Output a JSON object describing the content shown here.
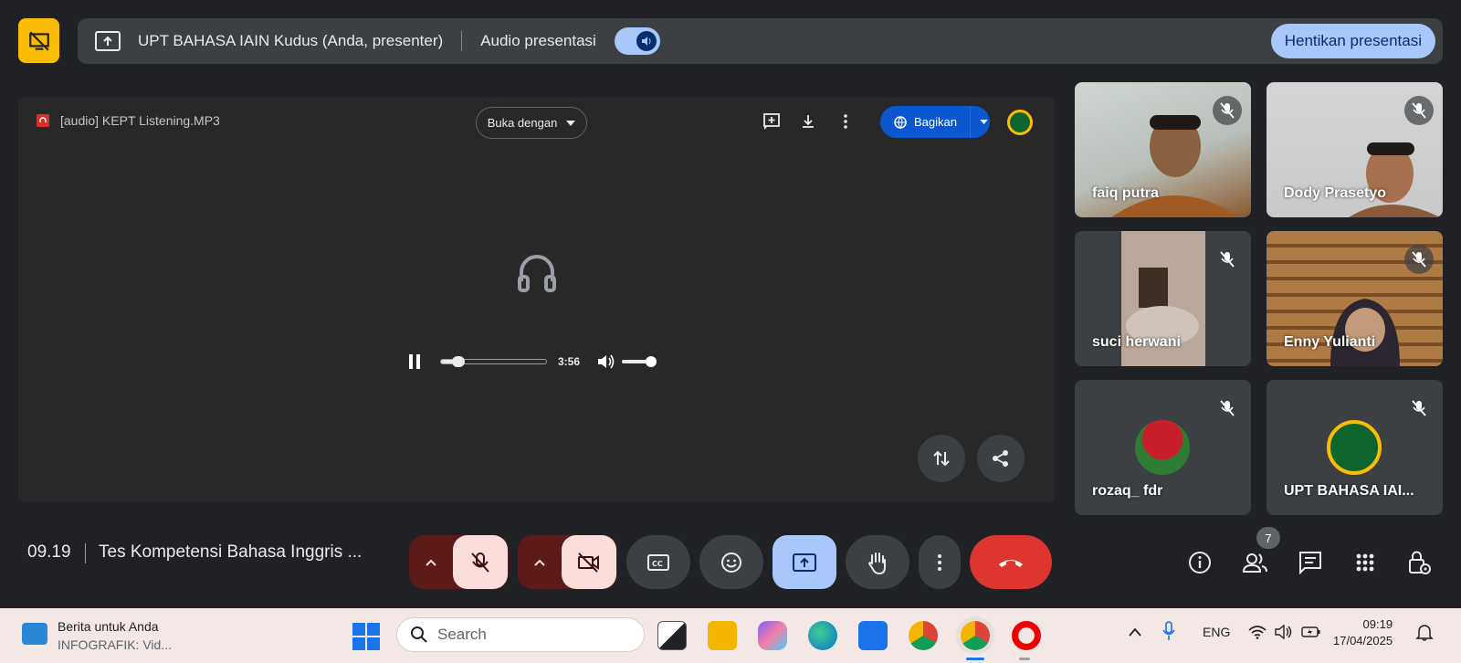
{
  "banner": {
    "presenter_text": "UPT BAHASA IAIN Kudus (Anda, presenter)",
    "audio_label": "Audio presentasi",
    "stop_button": "Hentikan presentasi"
  },
  "stage": {
    "file_name": "[audio] KEPT Listening.MP3",
    "open_with": "Buka dengan",
    "share_button": "Bagikan",
    "player": {
      "duration": "3:56",
      "progress": 0.1,
      "volume": 1.0
    }
  },
  "participants": [
    {
      "name": "faiq putra",
      "muted": true
    },
    {
      "name": "Dody Prasetyo",
      "muted": true
    },
    {
      "name": "suci herwani",
      "muted": true
    },
    {
      "name": "Enny Yulianti",
      "muted": true
    },
    {
      "name": "rozaq_ fdr",
      "muted": true
    },
    {
      "name": "UPT BAHASA IAI...",
      "muted": true
    }
  ],
  "controls": {
    "time": "09.19",
    "meeting_title": "Tes Kompetensi Bahasa Inggris ...",
    "participant_count": "7"
  },
  "taskbar": {
    "news_title": "Berita untuk Anda",
    "news_subtitle": "INFOGRAFIK: Vid...",
    "search_placeholder": "Search",
    "language": "ENG",
    "time": "09:19",
    "date": "17/04/2025"
  },
  "colors": {
    "meet_bg": "#202124",
    "accent_blue": "#a8c7fa",
    "hangup_red": "#dc362e",
    "muted_bg": "#f9dedc"
  }
}
